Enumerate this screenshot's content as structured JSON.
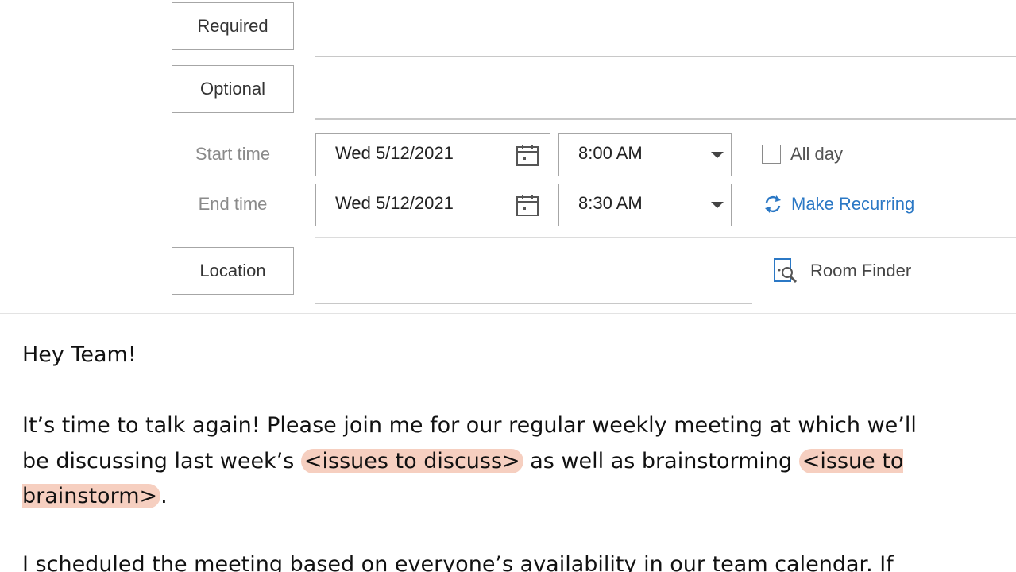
{
  "header": {
    "required_label": "Required",
    "optional_label": "Optional",
    "location_label": "Location",
    "start_time_label": "Start time",
    "end_time_label": "End time",
    "start_date": "Wed 5/12/2021",
    "start_time": "8:00 AM",
    "end_date": "Wed 5/12/2021",
    "end_time": "8:30 AM",
    "all_day_label": "All day",
    "all_day_checked": false,
    "make_recurring_label": "Make Recurring",
    "room_finder_label": "Room Finder"
  },
  "body": {
    "greeting": "Hey Team!",
    "p1_part1": "It’s time to talk again! Please join me for our regular weekly meeting at which we’ll be discussing last week’s ",
    "p1_highlight1": "<issues to discuss>",
    "p1_part2": " as well as brainstorming ",
    "p1_highlight2": "<issue to brainstorm>",
    "p1_part3": ".",
    "p2": "I scheduled the meeting based on everyone’s availability in our team calendar. If"
  },
  "colors": {
    "link_blue": "#2b78c5",
    "highlight": "#f6cfc0",
    "border_gray": "#a6a6a6"
  },
  "icons": {
    "calendar": "calendar-icon",
    "dropdown": "chevron-down-icon",
    "recurring": "recurring-icon",
    "room_finder": "room-finder-icon"
  }
}
